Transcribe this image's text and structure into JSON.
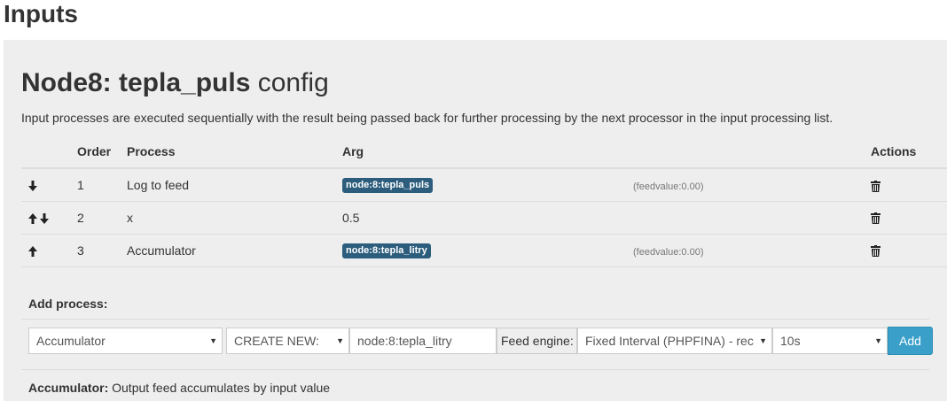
{
  "page": {
    "heading": "Inputs"
  },
  "modal": {
    "title_bold": "Node8: tepla_puls",
    "title_light": " config",
    "description": "Input processes are executed sequentially with the result being passed back for further processing by the next processor in the input processing list."
  },
  "table": {
    "headers": {
      "order": "Order",
      "process": "Process",
      "arg": "Arg",
      "actions": "Actions"
    },
    "rows": [
      {
        "arrows": [
          "down"
        ],
        "order": "1",
        "process": "Log to feed",
        "arg": "node:8:tepla_puls",
        "arg_is_badge": true,
        "value": "(feedvalue:0.00)"
      },
      {
        "arrows": [
          "up",
          "down"
        ],
        "order": "2",
        "process": "x",
        "arg": "0.5",
        "arg_is_badge": false,
        "value": ""
      },
      {
        "arrows": [
          "up"
        ],
        "order": "3",
        "process": "Accumulator",
        "arg": "node:8:tepla_litry",
        "arg_is_badge": true,
        "value": "(feedvalue:0.00)"
      }
    ]
  },
  "add_process": {
    "label": "Add process:",
    "process_select": "Accumulator",
    "feed_select": "CREATE NEW:",
    "feed_name_input": "node:8:tepla_litry",
    "engine_label": "Feed engine:",
    "engine_select": "Fixed Interval (PHPFINA) - rec",
    "interval_select": "10s",
    "add_button": "Add"
  },
  "help": {
    "name": "Accumulator:",
    "text": " Output feed accumulates by input value"
  },
  "colors": {
    "badge": "#2c5d7d",
    "add_button": "#3aa0c9",
    "panel_bg": "#eeeeee"
  }
}
